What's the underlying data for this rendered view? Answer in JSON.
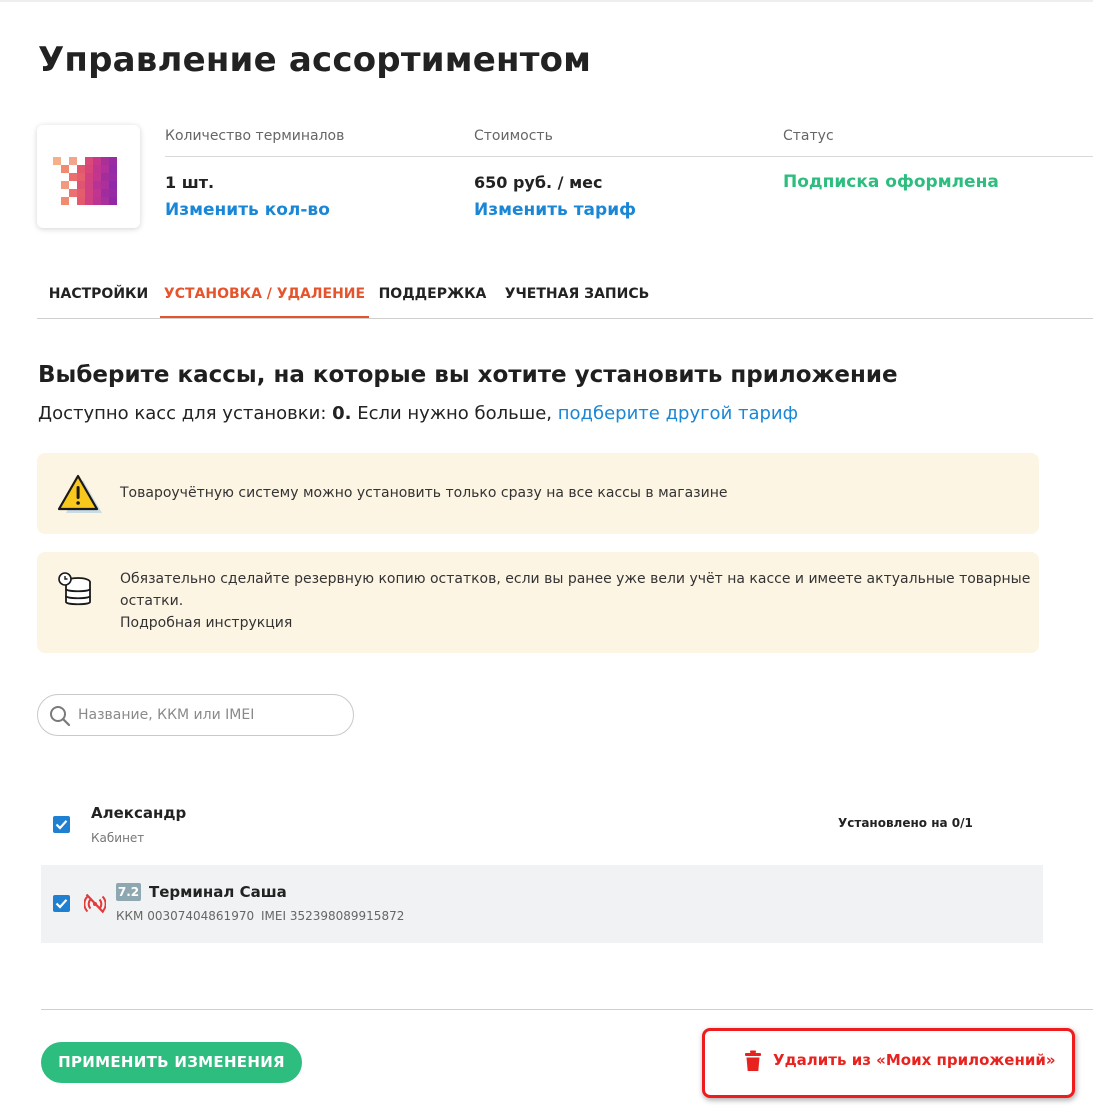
{
  "page": {
    "title": "Управление ассортиментом"
  },
  "app_info": {
    "terminals_label": "Количество терминалов",
    "terminals_value": "1 шт.",
    "terminals_link": "Изменить кол-во",
    "cost_label": "Стоимость",
    "cost_value": "650 руб. / мес",
    "cost_link": "Изменить тариф",
    "status_label": "Статус",
    "status_value": "Подписка оформлена",
    "status_color": "#2dbd7e"
  },
  "tabs": [
    {
      "label": "НАСТРОЙКИ",
      "active": false
    },
    {
      "label": "УСТАНОВКА / УДАЛЕНИЕ",
      "active": true
    },
    {
      "label": "ПОДДЕРЖКА",
      "active": false
    },
    {
      "label": "УЧЕТНАЯ ЗАПИСЬ",
      "active": false
    }
  ],
  "install": {
    "heading": "Выберите кассы, на которые вы хотите установить приложение",
    "available_prefix": "Доступно касс для установки: ",
    "available_count": "0.",
    "available_suffix": " Если нужно больше, ",
    "available_link": "подберите другой тариф"
  },
  "notices": {
    "warning_text": "Товароучётную систему можно установить только сразу на все кассы в магазине",
    "warning_icon": "warning-triangle-icon",
    "backup_line1": "Обязательно сделайте резервную копию остатков, если вы ранее уже вели учёт на кассе и имеете актуальные товарные",
    "backup_line2": "остатки.",
    "backup_link": "Подробная инструкция",
    "backup_icon": "database-clock-icon"
  },
  "search": {
    "placeholder": "Название, ККМ или IMEI",
    "value": ""
  },
  "store_group": {
    "name": "Александр",
    "subtitle": "Кабинет",
    "status": "Установлено на 0/1",
    "checked": true
  },
  "terminal": {
    "version": "7.2",
    "name": "Терминал Саша",
    "kkm": "ККМ 00307404861970",
    "imei": "IMEI 352398089915872",
    "checked": true,
    "offline_icon": "no-signal-icon"
  },
  "footer": {
    "apply_label": "ПРИМЕНИТЬ ИЗМЕНЕНИЯ",
    "remove_label": "Удалить из «Моих приложений»",
    "accent_green": "#2dbd7e",
    "accent_red": "#e8231f",
    "link_blue": "#1a87d6",
    "tab_active_color": "#e5542c"
  }
}
